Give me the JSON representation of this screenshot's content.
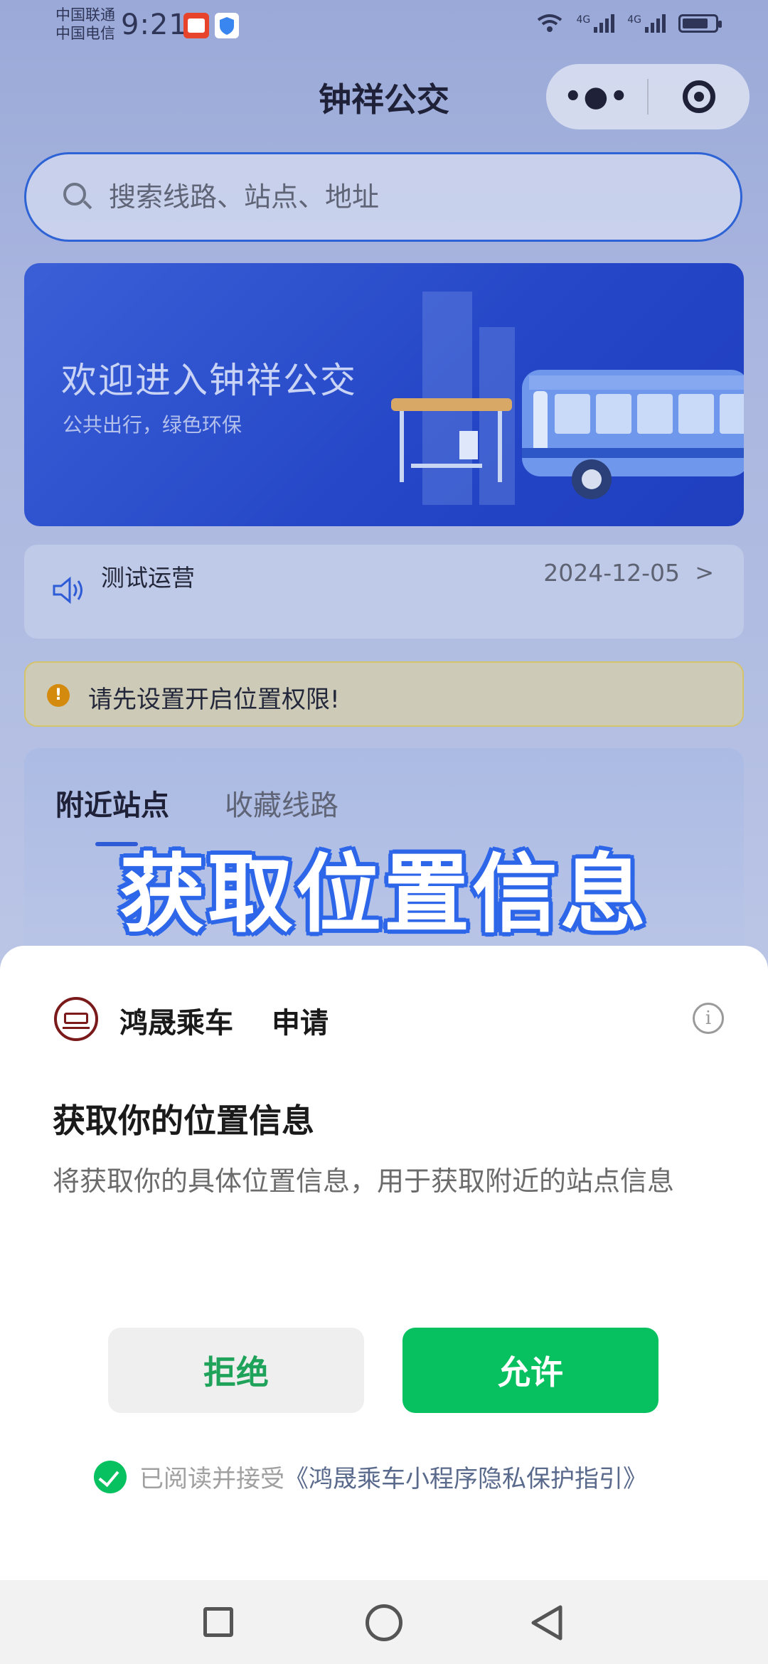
{
  "status_bar": {
    "carrier_1": "中国联通",
    "carrier_2": "中国电信",
    "time": "9:21",
    "signal_1": "4G",
    "signal_2": "4G"
  },
  "header": {
    "title": "钟祥公交",
    "more_icon": "more-dots-icon",
    "close_icon": "target-icon"
  },
  "search": {
    "placeholder": "搜索线路、站点、地址"
  },
  "banner": {
    "title": "欢迎进入钟祥公交",
    "subtitle": "公共出行，绿色环保"
  },
  "notice": {
    "title": "测试运营",
    "date": "2024-12-05"
  },
  "warning": {
    "icon_text": "!",
    "text": "请先设置开启位置权限!"
  },
  "tabs": [
    {
      "label": "附近站点",
      "active": true
    },
    {
      "label": "收藏线路",
      "active": false
    }
  ],
  "overlay_caption": "获取位置信息",
  "permission_sheet": {
    "app_name": "鸿晟乘车",
    "request_word": "申请",
    "info_icon_glyph": "i",
    "title": "获取你的位置信息",
    "description": "将获取你的具体位置信息，用于获取附近的站点信息",
    "deny_label": "拒绝",
    "allow_label": "允许",
    "agree_prefix": "已阅读并接受",
    "agree_link": "《鸿晟乘车小程序隐私保护指引》",
    "agree_checked": true
  },
  "colors": {
    "accent_blue": "#2e63d6",
    "allow_green": "#07c160",
    "caption_outline": "#2d66e8",
    "warning_orange": "#d48a0d"
  }
}
